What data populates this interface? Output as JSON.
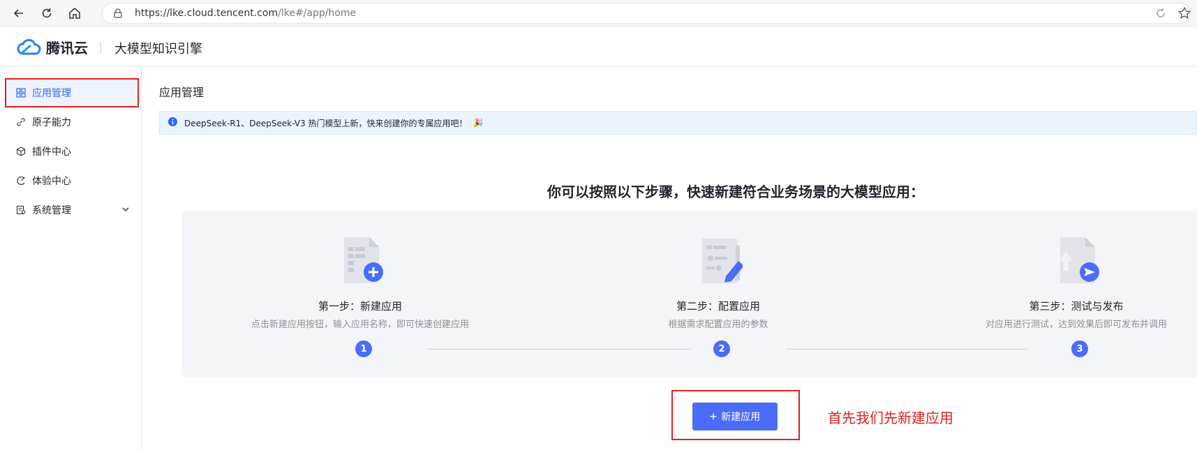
{
  "browser": {
    "url_host": "https://lke.cloud.tencent.com",
    "url_path": "/lke#/app/home"
  },
  "header": {
    "brand": "腾讯云",
    "product": "大模型知识引擎"
  },
  "sidebar": {
    "items": [
      {
        "label": "应用管理",
        "icon": "grid-icon",
        "active": true
      },
      {
        "label": "原子能力",
        "icon": "link-icon"
      },
      {
        "label": "插件中心",
        "icon": "cube-icon"
      },
      {
        "label": "体验中心",
        "icon": "experience-icon"
      },
      {
        "label": "系统管理",
        "icon": "settings-doc-icon",
        "expandable": true
      }
    ]
  },
  "main": {
    "title": "应用管理",
    "notice": "DeepSeek-R1、DeepSeek-V3 热门模型上新，快来创建你的专属应用吧！",
    "heading": "你可以按照以下步骤，快速新建符合业务场景的大模型应用：",
    "steps": [
      {
        "title": "第一步：新建应用",
        "desc": "点击新建应用按钮，输入应用名称，即可快速创建应用",
        "num": "1"
      },
      {
        "title": "第二步：配置应用",
        "desc": "根据需求配置应用的参数",
        "num": "2"
      },
      {
        "title": "第三步：测试与发布",
        "desc": "对应用进行测试，达到效果后即可发布并调用",
        "num": "3"
      }
    ],
    "create_button": "新建应用",
    "annotation": "首先我们先新建应用"
  },
  "colors": {
    "primary": "#4a6cf7",
    "highlight": "#e02020",
    "notice_bg": "#eaf4ff"
  }
}
